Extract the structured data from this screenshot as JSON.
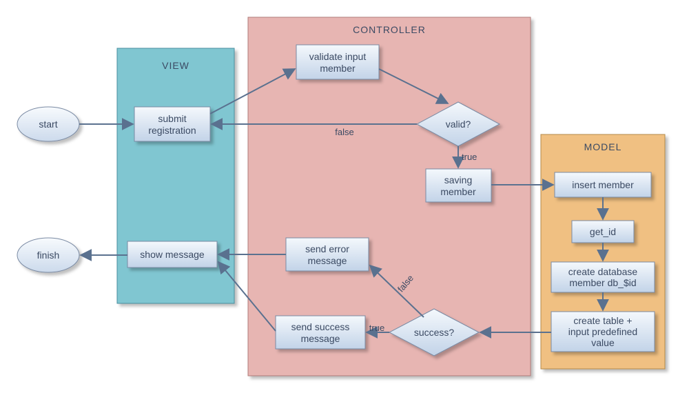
{
  "containers": {
    "view": {
      "title": "VIEW"
    },
    "controller": {
      "title": "CONTROLLER"
    },
    "model": {
      "title": "MODEL"
    }
  },
  "nodes": {
    "start": {
      "label": "start"
    },
    "finish": {
      "label": "finish"
    },
    "submit": {
      "line1": "submit",
      "line2": "registration"
    },
    "showmsg": {
      "line1": "show message"
    },
    "validate": {
      "line1": "validate input",
      "line2": "member"
    },
    "senderr": {
      "line1": "send error",
      "line2": "message"
    },
    "sendsucc": {
      "line1": "send success",
      "line2": "message"
    },
    "saving": {
      "line1": "saving",
      "line2": "member"
    },
    "insert": {
      "line1": "insert member"
    },
    "getid": {
      "line1": "get_id"
    },
    "createdb": {
      "line1": "create database",
      "line2": "member db_$id"
    },
    "createtbl": {
      "line1": "create table +",
      "line2": "input predefined",
      "line3": "value"
    },
    "valid": {
      "label": "valid?"
    },
    "success": {
      "label": "success?"
    }
  },
  "edges": {
    "false1": "false",
    "true1": "true",
    "false2": "false",
    "true2": "true"
  }
}
